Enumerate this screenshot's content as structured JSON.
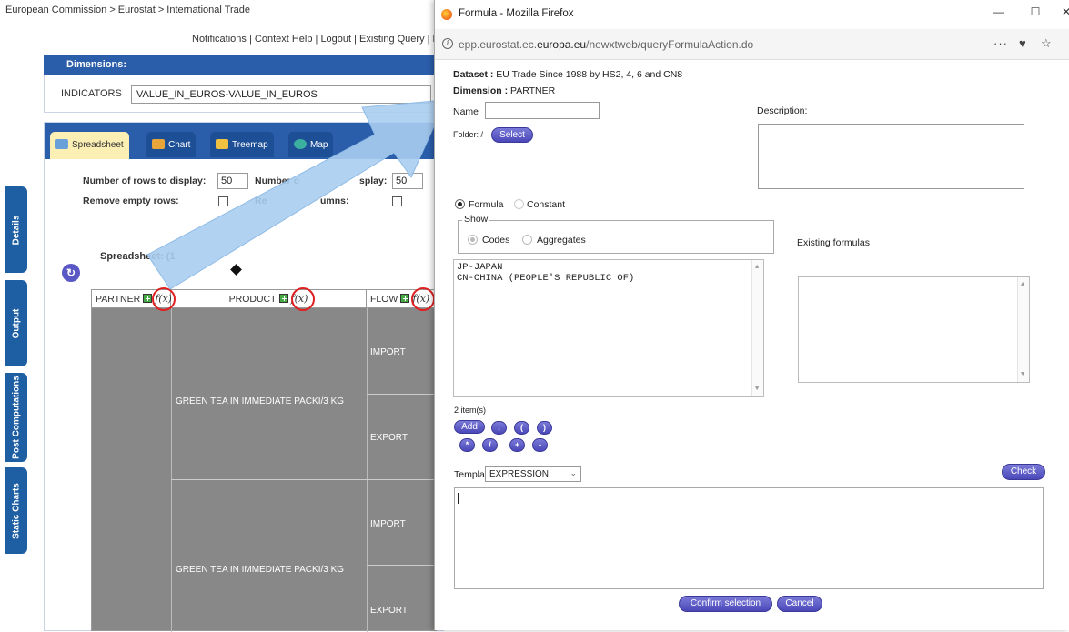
{
  "bg": {
    "breadcrumb": "European Commission > Eurostat > International Trade",
    "top_links": "Notifications | Context Help | Logout | Existing Query | B",
    "side_tabs": [
      "Details",
      "Output",
      "Post Computations",
      "Static Charts"
    ],
    "dimensions_header": "Dimensions:",
    "indicators_label": "INDICATORS",
    "indicators_value": "VALUE_IN_EUROS-VALUE_IN_EUROS",
    "tabs": [
      "Spreadsheet",
      "Chart",
      "Treemap",
      "Map"
    ],
    "rows_label": "Number of rows to display:",
    "rows_value": "50",
    "cols_label_a": "Number o",
    "cols_label_b": "splay:",
    "cols_value": "50",
    "remove_rows_label": "Remove empty rows:",
    "remove_cols_label_a": "Re",
    "remove_cols_label_b": "umns:",
    "spreadsheet_title": "Spreadsheet: (1",
    "grid_headers": {
      "partner": "PARTNER",
      "product": "PRODUCT",
      "flow": "FLOW"
    },
    "fx_label": "f(x)",
    "product_1": "GREEN TEA IN IMMEDIATE PACKI/3 KG",
    "product_2": "GREEN TEA IN IMMEDIATE PACKI/3 KG",
    "flows": [
      "IMPORT",
      "EXPORT",
      "IMPORT",
      "EXPORT"
    ]
  },
  "popup": {
    "window_title": "Formula - Mozilla Firefox",
    "url_pre": "epp.eurostat.ec.",
    "url_bold": "europa.eu",
    "url_post": "/newxtweb/queryFormulaAction.do",
    "dataset_label": "Dataset :",
    "dataset_value": " EU Trade Since 1988 by HS2, 4, 6 and CN8",
    "dimension_label": "Dimension :",
    "dimension_value": " PARTNER",
    "name_label": "Name",
    "name_value": "",
    "description_label": "Description:",
    "folder_label": "Folder: /",
    "select_button": "Select",
    "formula_label": "Formula",
    "constant_label": "Constant",
    "show_legend": "Show",
    "codes_label": "Codes",
    "aggregates_label": "Aggregates",
    "existing_formulas_label": "Existing formulas",
    "items": [
      "JP-JAPAN",
      "CN-CHINA (PEOPLE'S REPUBLIC OF)"
    ],
    "items_count": "2 item(s)",
    "add_button": "Add",
    "operators_row1": [
      ",",
      "(",
      ")"
    ],
    "operators_row2": [
      "*",
      "/",
      "+",
      "-"
    ],
    "templates_label": "Templates",
    "templates_value": "EXPRESSION",
    "check_button": "Check",
    "confirm_button": "Confirm selection",
    "cancel_button": "Cancel"
  },
  "colors": {
    "nav_blue": "#2a5daa",
    "side_tab_blue": "#1e5ea3",
    "button_purple": "#5a58c4",
    "grid_gray": "#888888",
    "highlight_red": "#e02020",
    "arrow_blue": "#a8cdf0"
  }
}
